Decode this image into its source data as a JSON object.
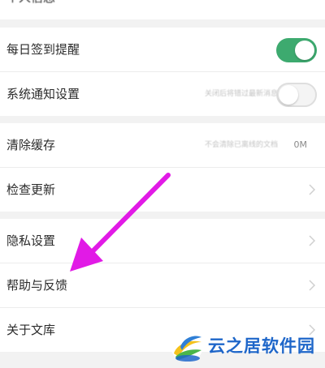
{
  "settings": {
    "partial_top": {
      "label": "个人信息"
    },
    "daily_checkin": {
      "label": "每日签到提醒",
      "toggle": "on"
    },
    "system_notify": {
      "label": "系统通知设置",
      "hint": "关闭后将错过最新消息",
      "toggle": "off"
    },
    "clear_cache": {
      "label": "清除缓存",
      "hint": "不会清除已离线的文档",
      "value": "0M"
    },
    "check_update": {
      "label": "检查更新"
    },
    "privacy": {
      "label": "隐私设置"
    },
    "help_feedback": {
      "label": "帮助与反馈"
    },
    "about": {
      "label": "关于文库"
    }
  },
  "watermark": {
    "text": "云之居软件园"
  },
  "colors": {
    "toggle_on": "#3daa6f",
    "arrow": "#e11ae6",
    "background": "#f2f2f2",
    "watermark": "#1e66c9"
  }
}
